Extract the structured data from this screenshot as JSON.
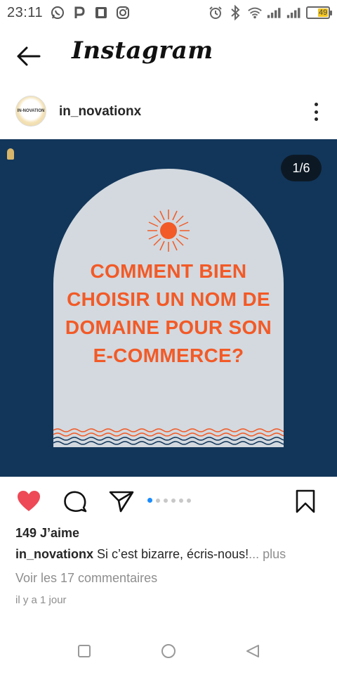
{
  "status_bar": {
    "time": "23:11",
    "battery_level": "49",
    "left_icons": [
      "whatsapp-icon",
      "parking-icon",
      "publisher-icon",
      "instagram-icon"
    ],
    "right_icons": [
      "alarm-icon",
      "bluetooth-icon",
      "wifi-icon",
      "signal-icon",
      "signal-icon",
      "battery-icon"
    ]
  },
  "header": {
    "app_name": "Instagram"
  },
  "post": {
    "username": "in_novationx",
    "avatar_text": "IN-NOVATION",
    "counter": "1/6",
    "image": {
      "headline": "COMMENT BIEN CHOISIR UN NOM DE DOMAINE POUR SON E-COMMERCE?",
      "background_color": "#12365a",
      "arch_color": "#d3d9df",
      "accent_color": "#f25a27"
    },
    "carousel_dots": 6,
    "carousel_active_index": 0,
    "likes": "149 J’aime",
    "caption_user": "in_novationx",
    "caption_text": " Si c’est bizarre, écris-nous!",
    "caption_more": "... plus",
    "comments_link": "Voir les 17 commentaires",
    "time_ago": "il y a 1 jour"
  },
  "colors": {
    "like_red": "#ed4956",
    "active_dot": "#1a8cff"
  }
}
